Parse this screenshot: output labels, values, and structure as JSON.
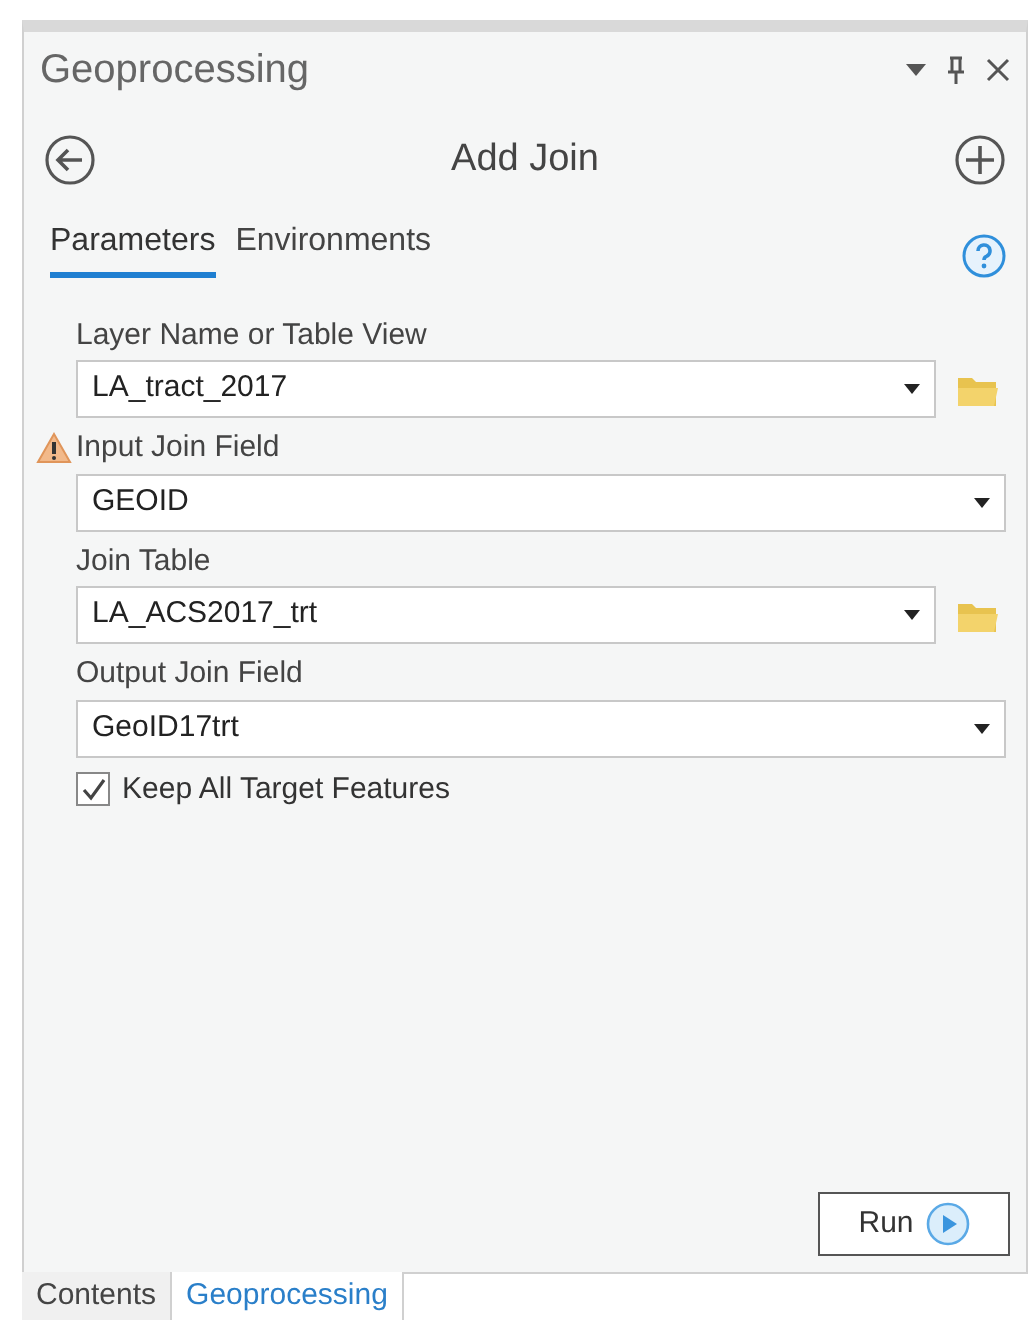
{
  "pane": {
    "title": "Geoprocessing"
  },
  "tool": {
    "title": "Add Join"
  },
  "tabs": [
    {
      "label": "Parameters",
      "selected": true
    },
    {
      "label": "Environments",
      "selected": false
    }
  ],
  "parameters": [
    {
      "label": "Layer Name or Table View",
      "value": "LA_tract_2017",
      "browse": true,
      "warning": false
    },
    {
      "label": "Input Join Field",
      "value": "GEOID",
      "browse": false,
      "warning": true
    },
    {
      "label": "Join Table",
      "value": "LA_ACS2017_trt",
      "browse": true,
      "warning": false
    },
    {
      "label": "Output Join Field",
      "value": "GeoID17trt",
      "browse": false,
      "warning": false
    }
  ],
  "keep_all": {
    "label": "Keep All Target Features",
    "checked": true
  },
  "run_button": {
    "label": "Run"
  },
  "bottom_tabs": [
    {
      "label": "Contents",
      "selected": false
    },
    {
      "label": "Geoprocessing",
      "selected": true
    }
  ]
}
